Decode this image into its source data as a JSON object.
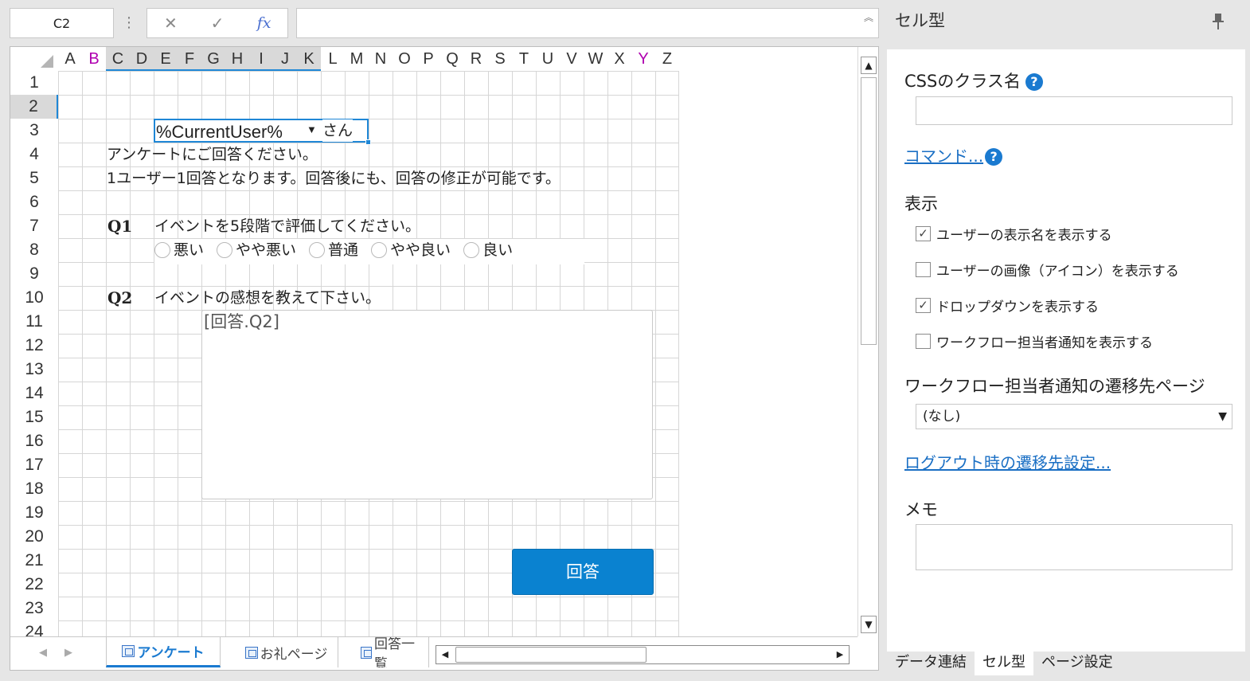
{
  "toolbar": {
    "namebox": "C2",
    "more": "⋮",
    "cancel": "✕",
    "confirm": "✓",
    "fx": "fx",
    "formula": "",
    "expand": "︽"
  },
  "sheet": {
    "columns": [
      "A",
      "B",
      "C",
      "D",
      "E",
      "F",
      "G",
      "H",
      "I",
      "J",
      "K",
      "L",
      "M",
      "N",
      "O",
      "P",
      "Q",
      "R",
      "S",
      "T",
      "U",
      "V",
      "W",
      "X",
      "Y",
      "Z"
    ],
    "rows": [
      "1",
      "2",
      "3",
      "4",
      "5",
      "6",
      "7",
      "8",
      "9",
      "10",
      "11",
      "12",
      "13",
      "14",
      "15",
      "16",
      "17",
      "18",
      "19",
      "20",
      "21",
      "22",
      "23",
      "24"
    ],
    "selected_row": "2",
    "cells": {
      "c2": "%CurrentUser%",
      "c2_arrow": "▼",
      "l2": "さん",
      "c3": "アンケートにご回答ください。",
      "c4": "1ユーザー1回答となります。回答後にも、回答の修正が可能です。",
      "c6": "Q1",
      "e6": "イベントを5段階で評価してください。",
      "c9": "Q2",
      "e9": "イベントの感想を教えて下さい。"
    },
    "radio_options": [
      "悪い",
      "やや悪い",
      "普通",
      "やや良い",
      "良い"
    ],
    "textarea": "[回答.Q2]",
    "answer_button": "回答"
  },
  "tabs": {
    "nav_prev": "◀",
    "nav_next": "▶",
    "items": [
      "アンケート",
      "お礼ページ",
      "回答一覧"
    ]
  },
  "panel": {
    "title": "セル型",
    "css_label": "CSSのクラス名",
    "help": "?",
    "command_link": "コマンド...",
    "display_label": "表示",
    "checkboxes": [
      {
        "label": "ユーザーの表示名を表示する",
        "checked": true
      },
      {
        "label": "ユーザーの画像（アイコン）を表示する",
        "checked": false
      },
      {
        "label": "ドロップダウンを表示する",
        "checked": true
      },
      {
        "label": "ワークフロー担当者通知を表示する",
        "checked": false
      }
    ],
    "workflow_label": "ワークフロー担当者通知の遷移先ページ",
    "workflow_value": "(なし)",
    "logout_link": "ログアウト時の遷移先設定...",
    "memo_label": "メモ",
    "bottom_tabs": [
      "データ連結",
      "セル型",
      "ページ設定"
    ]
  },
  "colors": {
    "accent": "#1a7ad0",
    "button": "#0a82d0",
    "highlight_column": "#b000b0"
  }
}
